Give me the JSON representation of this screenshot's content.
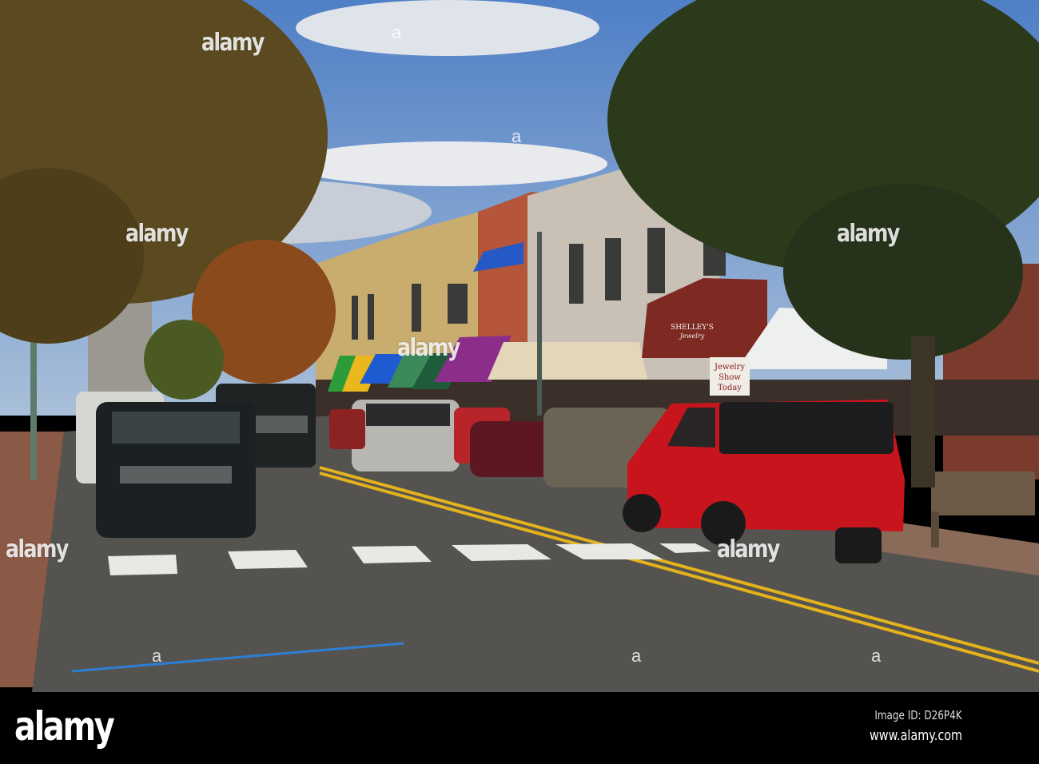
{
  "watermark": {
    "logo": "alamy",
    "dot": "a"
  },
  "footer": {
    "logo": "alamy",
    "image_id": "Image ID: D26P4K",
    "url": "www.alamy.com"
  },
  "storefront": {
    "awning_name": "SHELLEY'S",
    "awning_sub": "Jewelry",
    "sign_line1": "Jewelry",
    "sign_line2": "Show",
    "sign_line3": "Today"
  },
  "colors": {
    "sky": "#5b86c9",
    "road": "#55534f",
    "red_suv": "#c8141c",
    "awning_red": "#7e2a22"
  }
}
